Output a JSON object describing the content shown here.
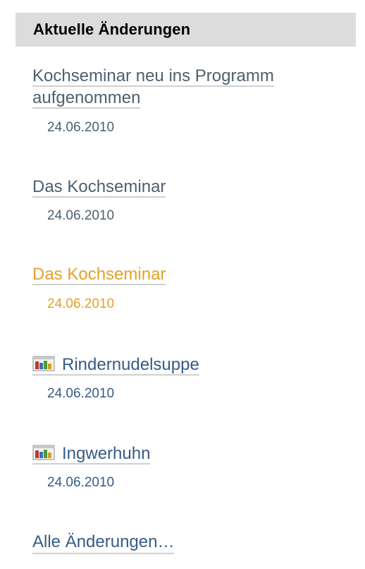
{
  "portlet": {
    "title": "Aktuelle Änderungen",
    "items": [
      {
        "line1": "Kochseminar neu ins Programm",
        "line2": "aufgenommen",
        "date": "24.06.2010"
      },
      {
        "title": "Das Kochseminar",
        "date": "24.06.2010"
      },
      {
        "title": "Das Kochseminar",
        "date": "24.06.2010"
      },
      {
        "title": "Rindernudelsuppe",
        "date": "24.06.2010",
        "icon": "document-icon"
      },
      {
        "title": "Ingwerhuhn",
        "date": "24.06.2010",
        "icon": "document-icon"
      }
    ],
    "all_changes_label": "Alle Änderungen…"
  },
  "colors": {
    "header_bg": "#dcdcdc",
    "link_gray": "#4c6071",
    "link_blue": "#365b86",
    "link_orange": "#e5a02a",
    "underline": "#d0d0d0"
  }
}
